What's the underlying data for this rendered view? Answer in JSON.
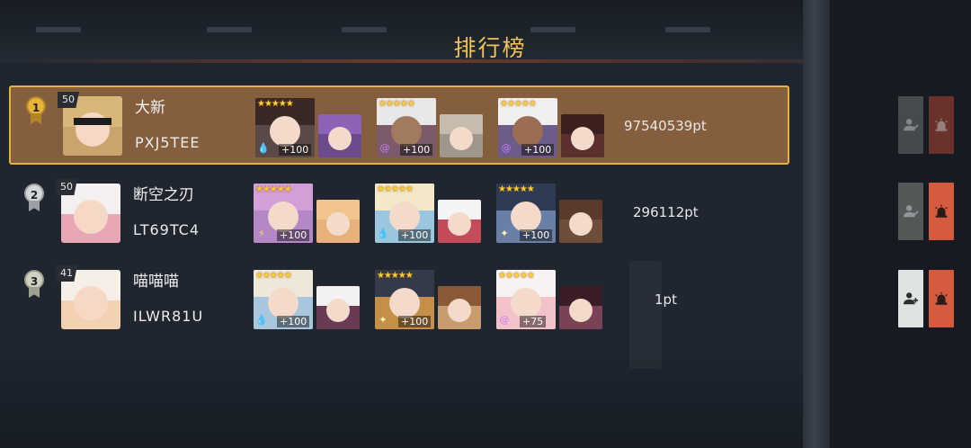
{
  "title": "排行榜",
  "colors": {
    "accent": "#f3c35a",
    "highlight_border": "#e7b23c",
    "action_red": "#d65a3e",
    "action_gray": "#6d7272"
  },
  "rows": [
    {
      "rank": "1",
      "medal": "gold",
      "level": "50",
      "name": "大新",
      "id": "PXJ5TEE",
      "score": "97540539pt",
      "highlighted": true,
      "team": [
        {
          "stars": "★★★★★",
          "plus": "+100",
          "element": "water-drop-icon"
        },
        {
          "stars": "★★★★★",
          "plus": "+100",
          "element": "spiral-icon"
        },
        {
          "stars": "★★★★★",
          "plus": "+100",
          "element": "spiral-icon"
        }
      ],
      "buttons": [
        {
          "name": "add-friend-icon",
          "state": "disabled"
        },
        {
          "name": "report-alarm-icon",
          "state": "disabled"
        }
      ]
    },
    {
      "rank": "2",
      "medal": "silver",
      "level": "50",
      "name": "断空之刃",
      "id": "LT69TC4",
      "score": "296112pt",
      "highlighted": false,
      "team": [
        {
          "stars": "★★★★★",
          "plus": "+100",
          "element": "lightning-icon"
        },
        {
          "stars": "★★★★★",
          "plus": "+100",
          "element": "water-drop-icon"
        },
        {
          "stars": "★★★★★",
          "plus": "+100",
          "element": "sparkle-icon"
        }
      ],
      "buttons": [
        {
          "name": "add-friend-icon",
          "state": "disabled"
        },
        {
          "name": "report-alarm-icon",
          "state": "active"
        }
      ]
    },
    {
      "rank": "3",
      "medal": "bronze",
      "level": "41",
      "name": "喵喵喵",
      "id": "ILWR81U",
      "score": "1pt",
      "highlighted": false,
      "team": [
        {
          "stars": "★★★★★",
          "plus": "+100",
          "element": "water-drop-icon"
        },
        {
          "stars": "★★★★★",
          "plus": "+100",
          "element": "sparkle-icon"
        },
        {
          "stars": "★★★★★",
          "plus": "+75",
          "element": "spiral-icon"
        }
      ],
      "buttons": [
        {
          "name": "add-friend-icon",
          "state": "active"
        },
        {
          "name": "report-alarm-icon",
          "state": "active"
        }
      ]
    }
  ]
}
